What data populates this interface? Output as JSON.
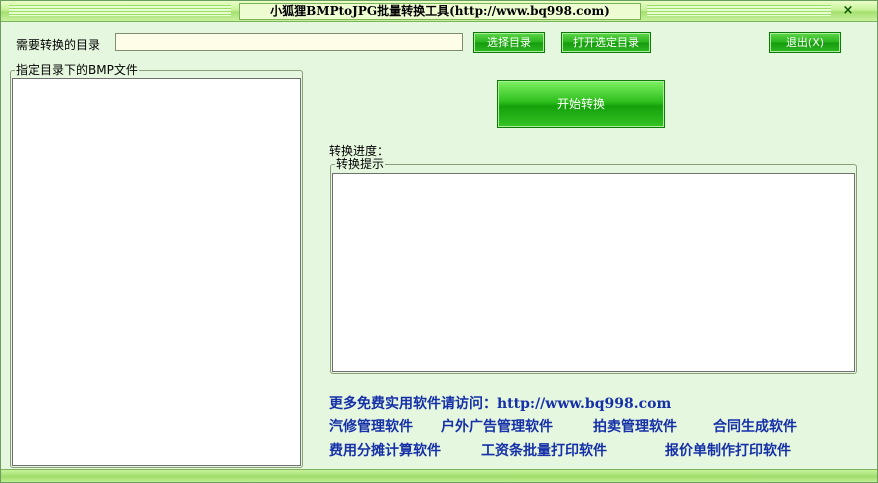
{
  "window": {
    "title": "小狐狸BMPtoJPG批量转换工具(http://www.bq998.com)",
    "close_glyph": "×"
  },
  "toolbar": {
    "dir_label": "需要转换的目录",
    "dir_value": "",
    "select_label": "选择目录",
    "open_label": "打开选定目录",
    "exit_label": "退出(X)"
  },
  "files_group": {
    "legend": "指定目录下的BMP文件"
  },
  "actions": {
    "start_label": "开始转换"
  },
  "progress": {
    "label": "转换进度："
  },
  "tips_group": {
    "legend": "转换提示"
  },
  "promo": {
    "visit_text": "更多免费实用软件请访问：http://www.bq998.com",
    "links_row1": [
      "汽修管理软件",
      "户外广告管理软件",
      "拍卖管理软件",
      "合同生成软件"
    ],
    "links_row2": [
      "费用分摊计算软件",
      "工资条批量打印软件",
      "报价单制作打印软件"
    ]
  },
  "colors": {
    "button_green": "#27b21a",
    "link_blue": "#1530a8",
    "background": "#e6f7df"
  }
}
